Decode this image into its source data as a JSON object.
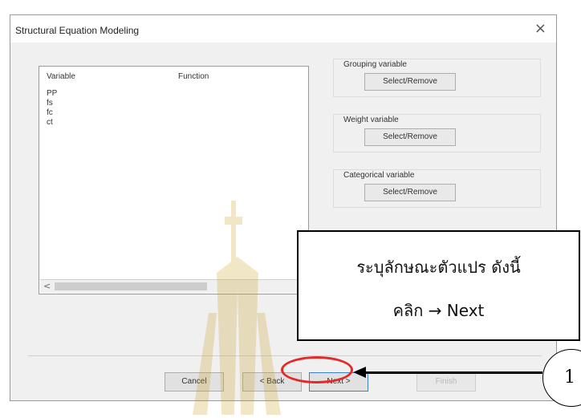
{
  "dialog": {
    "title": "Structural Equation Modeling",
    "close_glyph": "×"
  },
  "variable_list": {
    "headers": [
      "Variable",
      "Function"
    ],
    "rows": [
      "PP",
      "fs",
      "fc",
      "ct"
    ],
    "scroll_left_glyph": "<"
  },
  "groups": [
    {
      "label": "Grouping variable",
      "button": "Select/Remove"
    },
    {
      "label": "Weight variable",
      "button": "Select/Remove"
    },
    {
      "label": "Categorical variable",
      "button": "Select/Remove"
    }
  ],
  "footer_buttons": {
    "cancel": "Cancel",
    "back": "< Back",
    "next": "Next >",
    "finish": "Finish"
  },
  "callout": {
    "line1": "ระบุลักษณะตัวแปร ดังนี้",
    "line2": "คลิก → Next"
  },
  "step_marker": "1",
  "colors": {
    "highlight": "#e22a2a",
    "dialog_bg": "#f0f0f0",
    "watermark": "#c8a020"
  }
}
